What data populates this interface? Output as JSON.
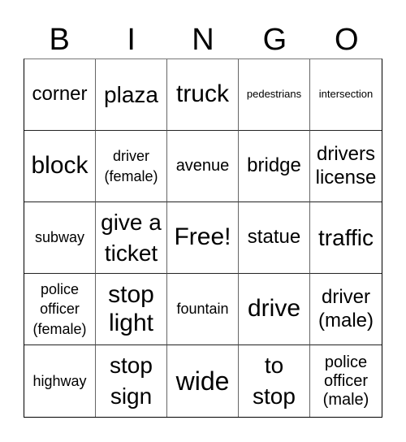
{
  "header": [
    "B",
    "I",
    "N",
    "G",
    "O"
  ],
  "cells": [
    {
      "text": "corner",
      "size": "s24"
    },
    {
      "text": "plaza",
      "size": "s28"
    },
    {
      "text": "truck",
      "size": "s30"
    },
    {
      "text": "pedestrians",
      "size": "s13"
    },
    {
      "text": "intersection",
      "size": "s13"
    },
    {
      "text": "block",
      "size": "s30"
    },
    {
      "text": "driver (female)",
      "size": "s18"
    },
    {
      "text": "avenue",
      "size": "s20"
    },
    {
      "text": "bridge",
      "size": "s24"
    },
    {
      "text": "drivers license",
      "size": "s24"
    },
    {
      "text": "subway",
      "size": "s18"
    },
    {
      "text": "give a ticket",
      "size": "s28"
    },
    {
      "text": "Free!",
      "size": "s30"
    },
    {
      "text": "statue",
      "size": "s24"
    },
    {
      "text": "traffic",
      "size": "s28"
    },
    {
      "text": "police officer (female)",
      "size": "s18"
    },
    {
      "text": "stop light",
      "size": "s30"
    },
    {
      "text": "fountain",
      "size": "s18"
    },
    {
      "text": "drive",
      "size": "s30"
    },
    {
      "text": "driver (male)",
      "size": "s24"
    },
    {
      "text": "highway",
      "size": "s18"
    },
    {
      "text": "stop sign",
      "size": "s28"
    },
    {
      "text": "wide",
      "size": "s32"
    },
    {
      "text": "to stop",
      "size": "s28"
    },
    {
      "text": "police officer (male)",
      "size": "s20"
    }
  ]
}
